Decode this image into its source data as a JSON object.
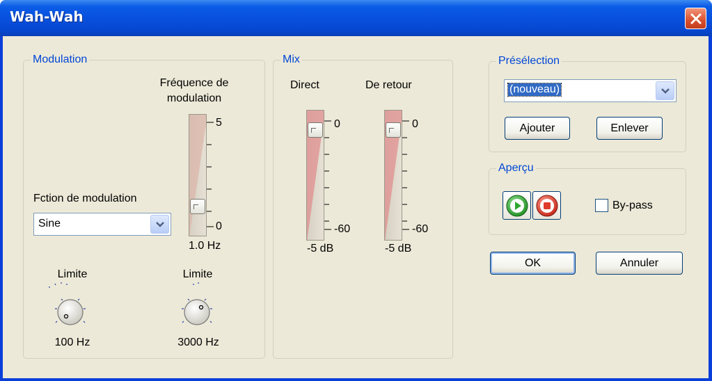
{
  "window": {
    "title": "Wah-Wah"
  },
  "modulation": {
    "legend": "Modulation",
    "freq_label_line1": "Fréquence de",
    "freq_label_line2": "modulation",
    "freq_scale_max": "5",
    "freq_scale_min": "0",
    "freq_value": "1.0 Hz",
    "freq_level": 0.2,
    "function_label": "Fction de modulation",
    "function_selected": "Sine",
    "limit_low_label": "Limite",
    "limit_low_value": "100 Hz",
    "limit_high_label": "Limite",
    "limit_high_value": "3000 Hz"
  },
  "mix": {
    "legend": "Mix",
    "direct_label": "Direct",
    "return_label": "De retour",
    "scale_max": "0",
    "scale_min": "-60",
    "direct_value": "-5 dB",
    "return_value": "-5 dB"
  },
  "preset": {
    "legend": "Présélection",
    "selected": "(nouveau)",
    "add_label": "Ajouter",
    "remove_label": "Enlever"
  },
  "preview": {
    "legend": "Aperçu",
    "bypass_label": "By-pass",
    "bypass_checked": false
  },
  "actions": {
    "ok_label": "OK",
    "cancel_label": "Annuler"
  },
  "colors": {
    "title_blue": "#0851de",
    "legend_blue": "#0046d5",
    "face": "#ece9d8",
    "close_red": "#d9502e",
    "play_green": "#2fa82f",
    "stop_red": "#e03c2b"
  }
}
